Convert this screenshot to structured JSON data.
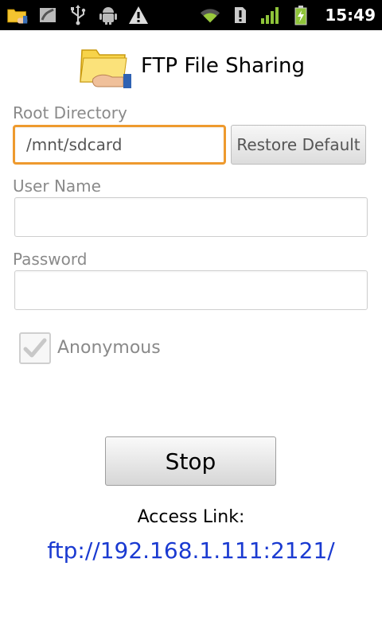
{
  "status_bar": {
    "time": "15:49",
    "icons": [
      "folder-share-icon",
      "gallery-icon",
      "usb-icon",
      "android-debug-icon",
      "warning-icon",
      "wifi-icon",
      "sim-alert-icon",
      "signal-icon",
      "battery-charging-icon"
    ]
  },
  "header": {
    "title": "FTP File Sharing"
  },
  "root_directory": {
    "label": "Root Directory",
    "value": "/mnt/sdcard",
    "restore_label": "Restore Default"
  },
  "user_name": {
    "label": "User Name",
    "value": ""
  },
  "password": {
    "label": "Password",
    "value": ""
  },
  "anonymous": {
    "label": "Anonymous",
    "checked": true
  },
  "stop_label": "Stop",
  "access": {
    "label": "Access Link:",
    "link": "ftp://192.168.1.111:2121/"
  },
  "colors": {
    "focus_border": "#ee9a2e",
    "link": "#1a3ad1"
  }
}
